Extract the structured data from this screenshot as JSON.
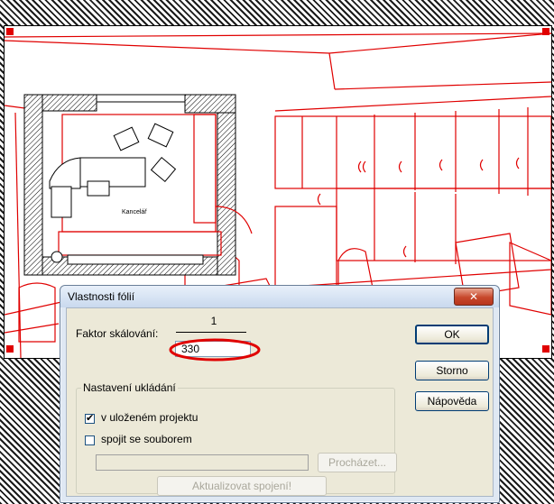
{
  "dialog": {
    "title": "Vlastnosti fólií",
    "close_glyph": "✕",
    "scale": {
      "label": "Faktor skálování:",
      "numerator": "1",
      "value": "330"
    },
    "save_group": {
      "title": "Nastavení ukládání",
      "in_project": {
        "label": "v uloženém projektu",
        "checked": true,
        "tick": "✔"
      },
      "link_file": {
        "label": "spojit se souborem",
        "checked": false
      },
      "file_path": "",
      "browse_label": "Procházet...",
      "update_label": "Aktualizovat spojení!"
    },
    "buttons": {
      "ok": "OK",
      "cancel": "Storno",
      "help": "Nápověda"
    }
  },
  "drawing": {
    "room_label": "Kancelář",
    "accent_color": "#e00000"
  }
}
